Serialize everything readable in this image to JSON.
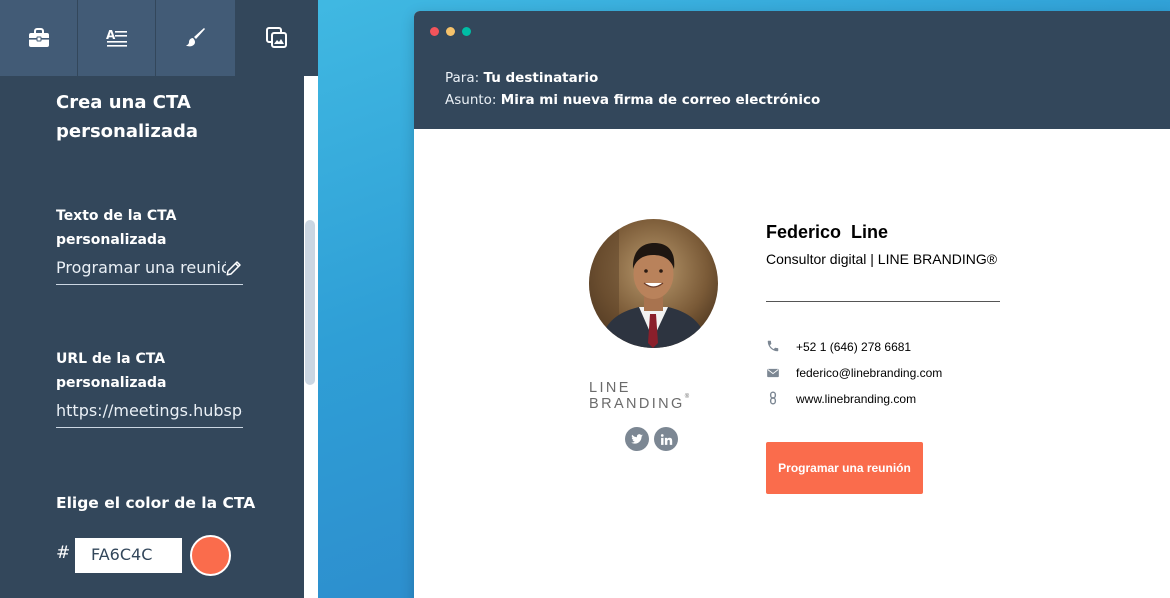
{
  "colors": {
    "panel": "#33475b",
    "toolbar_tab": "#425b76",
    "header": "#33475b",
    "cta": "#FA6C4C",
    "dot_red": "#f2545b",
    "dot_yellow": "#f5c26b",
    "dot_green": "#00bda5",
    "social_icon": "#7c8793"
  },
  "toolbar": {
    "tabs": [
      {
        "icon": "briefcase-icon"
      },
      {
        "icon": "text-format-icon"
      },
      {
        "icon": "brush-icon"
      },
      {
        "icon": "copy-image-icon",
        "active": true
      }
    ]
  },
  "editor": {
    "section_title": "Crea una CTA personalizada",
    "cta_text": {
      "label": "Texto de la CTA personalizada",
      "value": "Programar una reunión"
    },
    "cta_url": {
      "label": "URL de la CTA personalizada",
      "value": "https://meetings.hubspot"
    },
    "cta_color": {
      "label": "Elige el color de la CTA",
      "hash": "#",
      "value": "FA6C4C"
    }
  },
  "preview": {
    "to_key": "Para:",
    "to_value": "Tu destinatario",
    "subject_key": "Asunto:",
    "subject_value": "Mira mi nueva firma de correo electrónico",
    "signature": {
      "first_name": "Federico",
      "last_name": "Line",
      "role": "Consultor digital | LINE BRANDING®",
      "logo_text": "LINE BRANDING",
      "logo_mark": "®",
      "phone": "+52 1 (646) 278 6681",
      "email": "federico@linebranding.com",
      "website": "www.linebranding.com",
      "social": [
        "twitter-icon",
        "linkedin-icon"
      ],
      "cta_label": "Programar una reunión"
    }
  }
}
